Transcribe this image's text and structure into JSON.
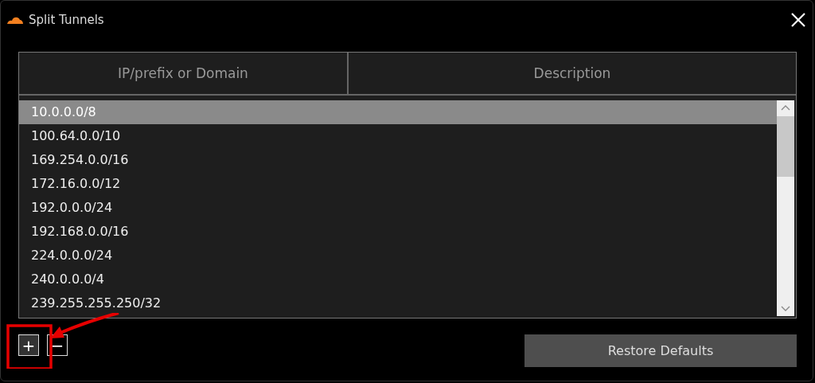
{
  "window": {
    "title": "Split Tunnels"
  },
  "table": {
    "columns": [
      "IP/prefix or Domain",
      "Description"
    ],
    "rows": [
      {
        "address": "10.0.0.0/8",
        "selected": true
      },
      {
        "address": "100.64.0.0/10",
        "selected": false
      },
      {
        "address": "169.254.0.0/16",
        "selected": false
      },
      {
        "address": "172.16.0.0/12",
        "selected": false
      },
      {
        "address": "192.0.0.0/24",
        "selected": false
      },
      {
        "address": "192.168.0.0/16",
        "selected": false
      },
      {
        "address": "224.0.0.0/24",
        "selected": false
      },
      {
        "address": "240.0.0.0/4",
        "selected": false
      },
      {
        "address": "239.255.255.250/32",
        "selected": false
      }
    ]
  },
  "buttons": {
    "add": "+",
    "remove": "−",
    "restore": "Restore Defaults"
  }
}
